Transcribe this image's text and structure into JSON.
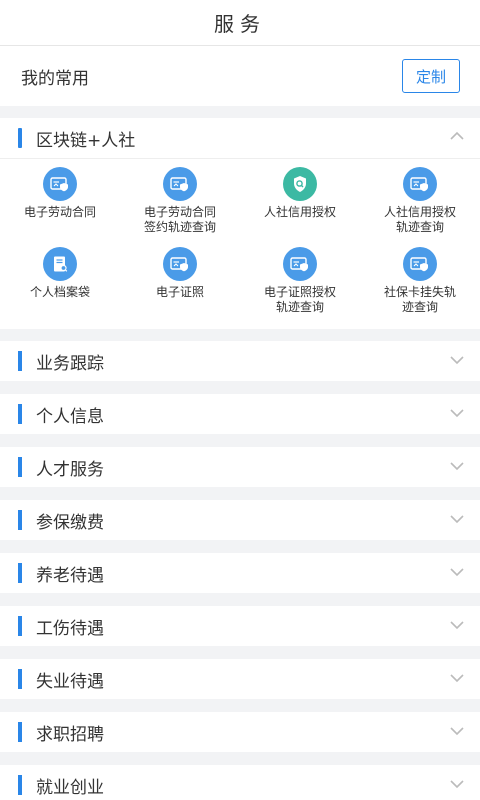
{
  "header": {
    "title": "服务"
  },
  "favorites": {
    "label": "我的常用",
    "customize_button": "定制"
  },
  "blockchain": {
    "title": "区块链+人社",
    "items": [
      {
        "label": "电子劳动合同",
        "icon": "id-card-shield-icon",
        "color": "#4a9be8"
      },
      {
        "label": "电子劳动合同\n签约轨迹查询",
        "icon": "id-card-shield-icon",
        "color": "#4a9be8"
      },
      {
        "label": "人社信用授权",
        "icon": "shield-search-icon",
        "color": "#3cb9a3"
      },
      {
        "label": "人社信用授权\n轨迹查询",
        "icon": "id-card-shield-icon",
        "color": "#4a9be8"
      },
      {
        "label": "个人档案袋",
        "icon": "file-search-icon",
        "color": "#4a9be8"
      },
      {
        "label": "电子证照",
        "icon": "id-card-shield-icon",
        "color": "#4a9be8"
      },
      {
        "label": "电子证照授权\n轨迹查询",
        "icon": "id-card-shield-icon",
        "color": "#4a9be8"
      },
      {
        "label": "社保卡挂失轨\n迹查询",
        "icon": "id-card-shield-icon",
        "color": "#4a9be8"
      }
    ]
  },
  "categories": [
    {
      "title": "业务跟踪"
    },
    {
      "title": "个人信息"
    },
    {
      "title": "人才服务"
    },
    {
      "title": "参保缴费"
    },
    {
      "title": "养老待遇"
    },
    {
      "title": "工伤待遇"
    },
    {
      "title": "失业待遇"
    },
    {
      "title": "求职招聘"
    },
    {
      "title": "就业创业"
    }
  ],
  "colors": {
    "accent": "#2a86e8"
  }
}
